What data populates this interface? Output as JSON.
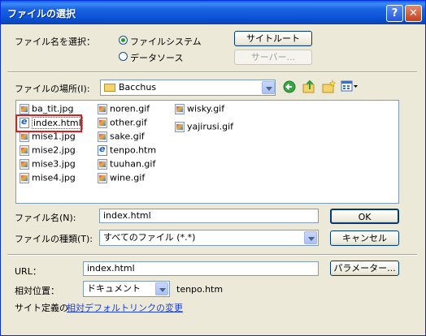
{
  "window": {
    "title": "ファイルの選択",
    "help": "?",
    "close": "✕"
  },
  "select_filename": {
    "label": "ファイル名を選択：",
    "options": [
      {
        "label": "ファイルシステム",
        "selected": true
      },
      {
        "label": "データソース",
        "selected": false
      }
    ],
    "site_root_button": "サイトルート",
    "server_button": "サーバー..."
  },
  "location": {
    "label": "ファイルの場所(I):",
    "value": "Bacchus"
  },
  "files": {
    "columns": [
      [
        {
          "name": "ba_tit.jpg",
          "icon": "image-file-icon"
        },
        {
          "name": "index.html",
          "icon": "html-file-icon",
          "selected": true
        },
        {
          "name": "mise1.jpg",
          "icon": "image-file-icon"
        },
        {
          "name": "mise2.jpg",
          "icon": "image-file-icon"
        },
        {
          "name": "mise3.jpg",
          "icon": "image-file-icon"
        },
        {
          "name": "mise4.jpg",
          "icon": "image-file-icon"
        }
      ],
      [
        {
          "name": "noren.gif",
          "icon": "image-file-icon"
        },
        {
          "name": "other.gif",
          "icon": "image-file-icon"
        },
        {
          "name": "sake.gif",
          "icon": "image-file-icon"
        },
        {
          "name": "tenpo.htm",
          "icon": "html-file-icon"
        },
        {
          "name": "tuuhan.gif",
          "icon": "image-file-icon"
        },
        {
          "name": "wine.gif",
          "icon": "image-file-icon"
        }
      ],
      [
        {
          "name": "wisky.gif",
          "icon": "image-file-icon"
        },
        {
          "name": "yajirusi.gif",
          "icon": "image-file-icon"
        }
      ]
    ]
  },
  "filename": {
    "label": "ファイル名(N):",
    "value": "index.html",
    "ok_button": "OK"
  },
  "filetype": {
    "label": "ファイルの種類(T):",
    "value": "すべてのファイル (*.*)",
    "cancel_button": "キャンセル"
  },
  "url": {
    "label": "URL：",
    "value": "index.html",
    "params_button": "パラメーター..."
  },
  "relative": {
    "label": "相対位置：",
    "value": "ドキュメント",
    "target": "tenpo.htm"
  },
  "site_def": {
    "prefix": "サイト定義の",
    "link": "相対デフォルトリンクの変更"
  },
  "colors": {
    "titlebar": "#0c55d8",
    "face": "#ece9d8",
    "selection": "#316ac5",
    "highlight_box": "#e01b1b",
    "link": "#1f3fd8"
  }
}
